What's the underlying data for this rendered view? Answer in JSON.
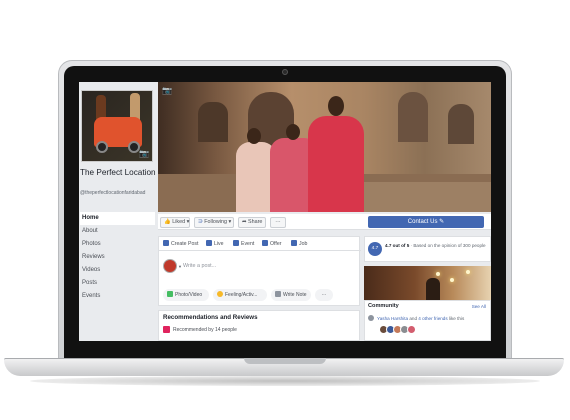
{
  "page": {
    "name": "The Perfect Location",
    "handle": "@theperfectlocationfaridabad"
  },
  "nav": {
    "items": [
      {
        "label": "Home",
        "active": true
      },
      {
        "label": "About"
      },
      {
        "label": "Photos"
      },
      {
        "label": "Reviews"
      },
      {
        "label": "Videos"
      },
      {
        "label": "Posts"
      },
      {
        "label": "Events"
      }
    ]
  },
  "actions": {
    "liked": "Liked",
    "following": "Following",
    "share": "Share",
    "more": "···",
    "contact": "Contact Us"
  },
  "composer": {
    "tabs": {
      "create_post": "Create Post",
      "live": "Live",
      "event": "Event",
      "offer": "Offer",
      "job": "Job"
    },
    "placeholder": "Write a post...",
    "buttons": {
      "photo_video": "Photo/Video",
      "feeling": "Feeling/Activ...",
      "write_note": "Write Note",
      "more": "···"
    }
  },
  "recommendations": {
    "title": "Recommendations and Reviews",
    "recommended_by": "Recommended by 14 people"
  },
  "rating": {
    "badge": "4.7",
    "score_text": "4.7 out of 5",
    "basis": " · Based on the opinion of 300 people"
  },
  "community": {
    "title": "Community",
    "see_all": "See All",
    "liker_name": "Yasha Harshita",
    "liker_connector": " and ",
    "liker_friends": "4 other friends",
    "liker_suffix": " like this"
  },
  "colors": {
    "brand_blue": "#4267b2",
    "background": "#e9ebee"
  }
}
